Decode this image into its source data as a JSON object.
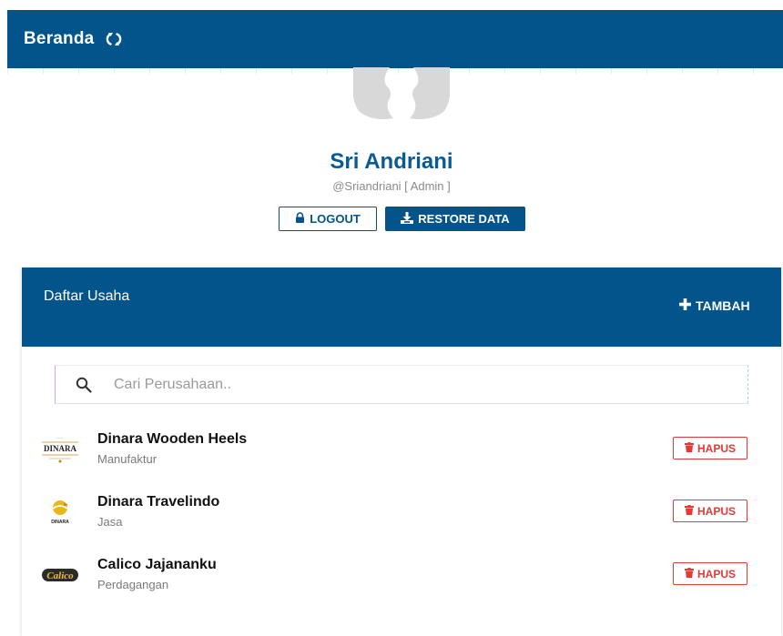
{
  "header": {
    "title": "Beranda",
    "refresh_icon": "refresh-icon"
  },
  "profile": {
    "name": "Sri Andriani",
    "handle": "@Sriandriani [ Admin ]",
    "logout_label": "LOGOUT",
    "restore_label": "RESTORE DATA"
  },
  "business_list": {
    "title": "Daftar Usaha",
    "add_label": "TAMBAH",
    "search_placeholder": "Cari Perusahaan..",
    "delete_label": "HAPUS",
    "items": [
      {
        "name": "Dinara Wooden Heels",
        "type": "Manufaktur",
        "logo_text": "DINARA"
      },
      {
        "name": "Dinara Travelindo",
        "type": "Jasa",
        "logo_text": "DINARA"
      },
      {
        "name": "Calico Jajananku",
        "type": "Perdagangan",
        "logo_text": "Calico"
      }
    ]
  },
  "colors": {
    "primary": "#03548a",
    "name_text": "#0a5a95",
    "danger": "#e53935",
    "logo_gold": "#d4a017"
  }
}
